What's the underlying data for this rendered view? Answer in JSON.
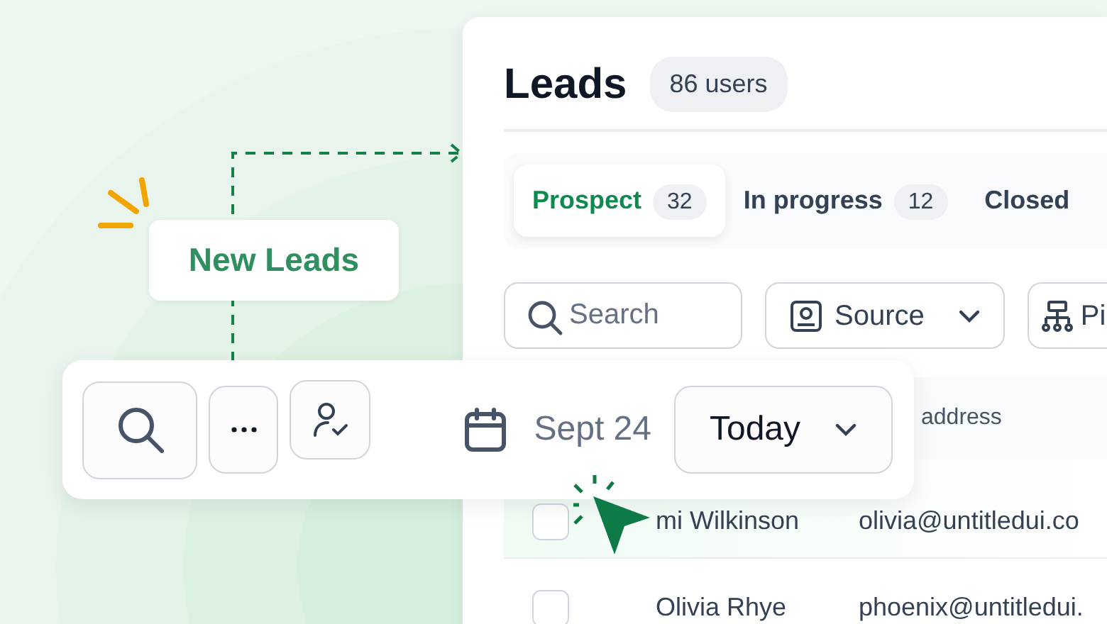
{
  "callout": {
    "label": "New Leads"
  },
  "leads_card": {
    "title": "Leads",
    "count_badge": "86 users",
    "tabs": [
      {
        "label": "Prospect",
        "count": "32",
        "selected": true
      },
      {
        "label": "In progress",
        "count": "12",
        "selected": false
      },
      {
        "label": "Closed",
        "selected": false
      }
    ],
    "search": {
      "placeholder": "Search"
    },
    "filters": [
      {
        "label": "Source",
        "kind": "source"
      },
      {
        "label": "Pi",
        "kind": "pipeline"
      }
    ],
    "table": {
      "column_2_header": "address",
      "rows": [
        {
          "checked": false,
          "name": "mi Wilkinson",
          "email": "olivia@untitledui.co"
        },
        {
          "checked": false,
          "name": "Olivia Rhye",
          "email": "phoenix@untitledui."
        }
      ]
    }
  },
  "toolbar": {
    "date": "Sept 24",
    "range": "Today"
  }
}
